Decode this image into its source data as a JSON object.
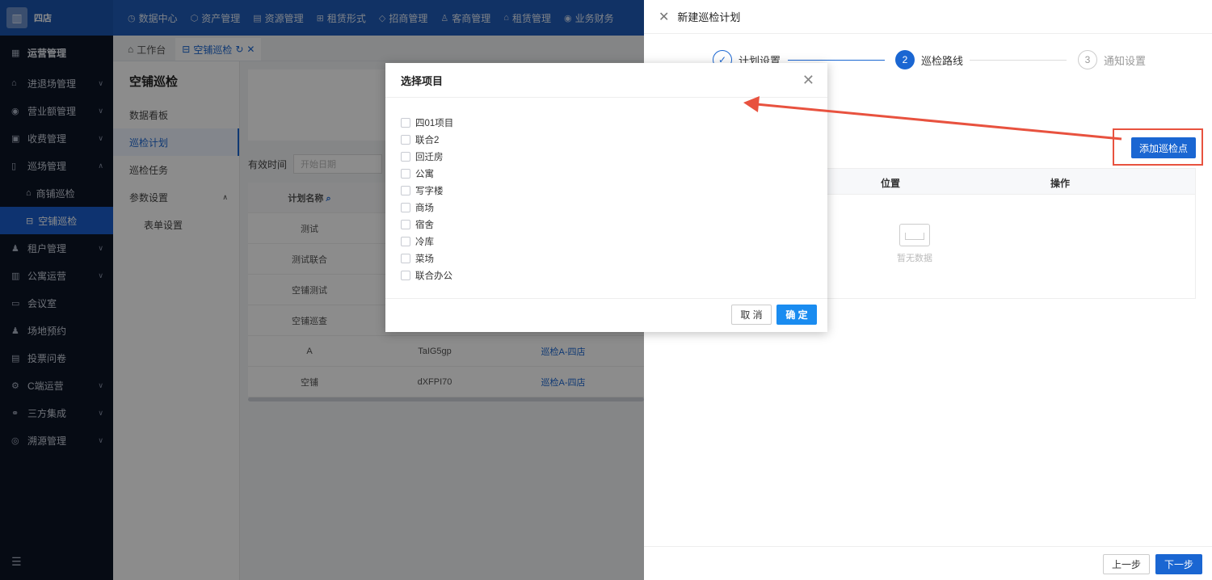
{
  "app": {
    "logo_text": "四店",
    "logo_icon": "building-icon"
  },
  "topnav": [
    {
      "label": "数据中心",
      "icon": "clock-icon"
    },
    {
      "label": "资产管理",
      "icon": "cube-icon"
    },
    {
      "label": "资源管理",
      "icon": "document-icon"
    },
    {
      "label": "租赁形式",
      "icon": "grid-icon"
    },
    {
      "label": "招商管理",
      "icon": "tag-icon"
    },
    {
      "label": "客商管理",
      "icon": "users-icon"
    },
    {
      "label": "租赁管理",
      "icon": "home-icon"
    },
    {
      "label": "业务财务",
      "icon": "coin-icon"
    }
  ],
  "sidebar": {
    "header": "运营管理",
    "items": [
      {
        "label": "进退场管理",
        "icon": "home-icon"
      },
      {
        "label": "营业额管理",
        "icon": "coin-icon"
      },
      {
        "label": "收费管理",
        "icon": "wallet-icon"
      },
      {
        "label": "巡场管理",
        "icon": "map-icon"
      }
    ],
    "sub_items": [
      {
        "label": "商铺巡检",
        "icon": "home-icon"
      },
      {
        "label": "空铺巡检",
        "icon": "store-icon"
      }
    ],
    "items_after": [
      {
        "label": "租户管理",
        "icon": "user-icon"
      },
      {
        "label": "公寓运营",
        "icon": "building-icon"
      },
      {
        "label": "会议室",
        "icon": "monitor-icon"
      },
      {
        "label": "场地预约",
        "icon": "user-icon"
      },
      {
        "label": "投票问卷",
        "icon": "form-icon"
      },
      {
        "label": "C端运营",
        "icon": "settings-icon"
      },
      {
        "label": "三方集成",
        "icon": "link-icon"
      },
      {
        "label": "溯源管理",
        "icon": "target-icon"
      }
    ]
  },
  "tabs": [
    {
      "label": "工作台"
    },
    {
      "label": "空铺巡检"
    }
  ],
  "submenu": {
    "title": "空铺巡检",
    "items": [
      "数据看板",
      "巡检计划",
      "巡检任务",
      "参数设置"
    ],
    "sub": "表单设置"
  },
  "main": {
    "filter_label": "有效时间",
    "date_placeholder": "开始日期",
    "table_head": [
      "计划名称",
      "",
      ""
    ],
    "rows": [
      [
        "测试",
        "",
        ""
      ],
      [
        "测试联合",
        "",
        ""
      ],
      [
        "空铺测试",
        "",
        ""
      ],
      [
        "空铺巡查",
        "",
        ""
      ],
      [
        "A",
        "TaIG5gp",
        "巡检A-四店"
      ],
      [
        "空铺",
        "dXFPI70",
        "巡检A-四店"
      ]
    ]
  },
  "drawer": {
    "title": "新建巡检计划",
    "steps": [
      {
        "num": "✓",
        "label": "计划设置"
      },
      {
        "num": "2",
        "label": "巡检路线"
      },
      {
        "num": "3",
        "label": "通知设置"
      }
    ],
    "add_button": "添加巡检点",
    "table_head": {
      "position": "位置",
      "operation": "操作"
    },
    "empty_text": "暂无数据",
    "prev_button": "上一步",
    "next_button": "下一步"
  },
  "modal": {
    "title": "选择项目",
    "options": [
      "四01项目",
      "联合2",
      "回迁房",
      "公寓",
      "写字楼",
      "商场",
      "宿舍",
      "冷库",
      "菜场",
      "联合办公"
    ],
    "cancel": "取 消",
    "ok": "确 定"
  },
  "colors": {
    "brand": "#1a66d2",
    "sidebar_bg": "#0c1426",
    "annotation": "#e8523f"
  }
}
